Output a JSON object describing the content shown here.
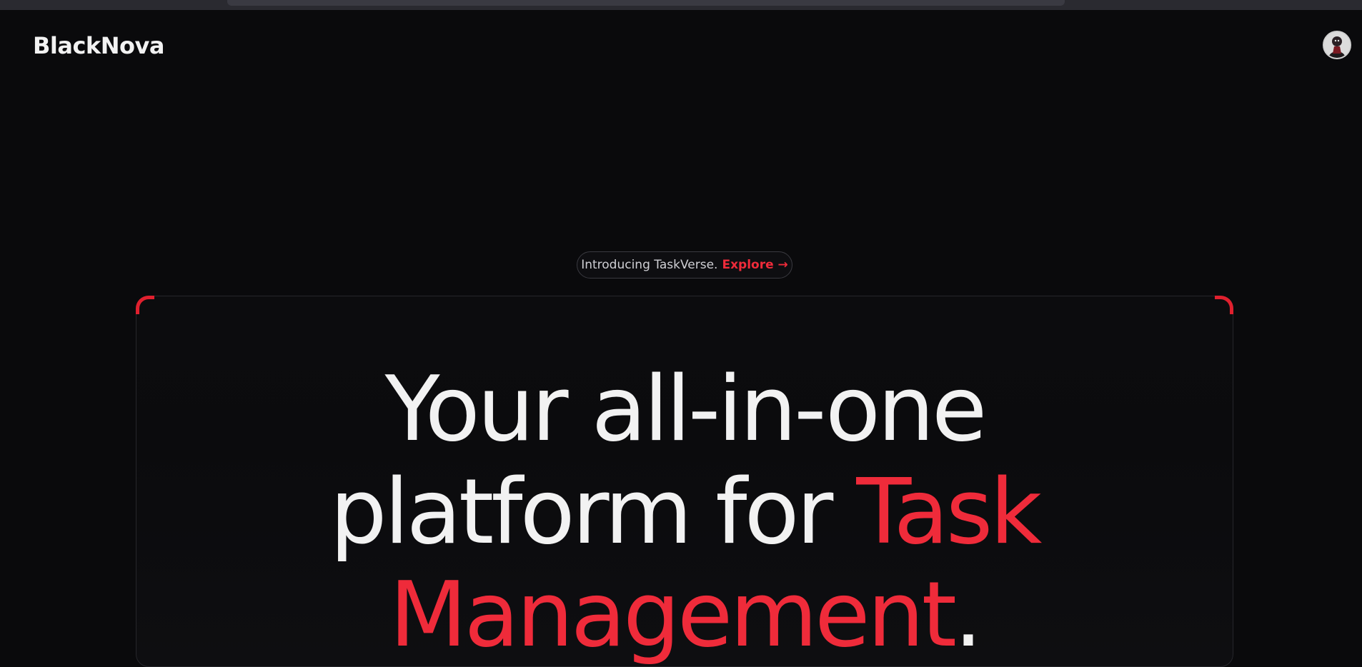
{
  "header": {
    "brand": "BlackNova",
    "avatar_icon": "user-avatar-icon"
  },
  "announcement": {
    "text": "Introducing TaskVerse.",
    "link_label": "Explore →"
  },
  "hero": {
    "line1": "Your all-in-one",
    "line2_plain": "platform for",
    "line2_accent": "Task",
    "line3_accent": "Management",
    "line3_tail": "."
  },
  "colors": {
    "background": "#0a0a0c",
    "accent": "#ef2b3a",
    "text": "#f2f2f2"
  }
}
